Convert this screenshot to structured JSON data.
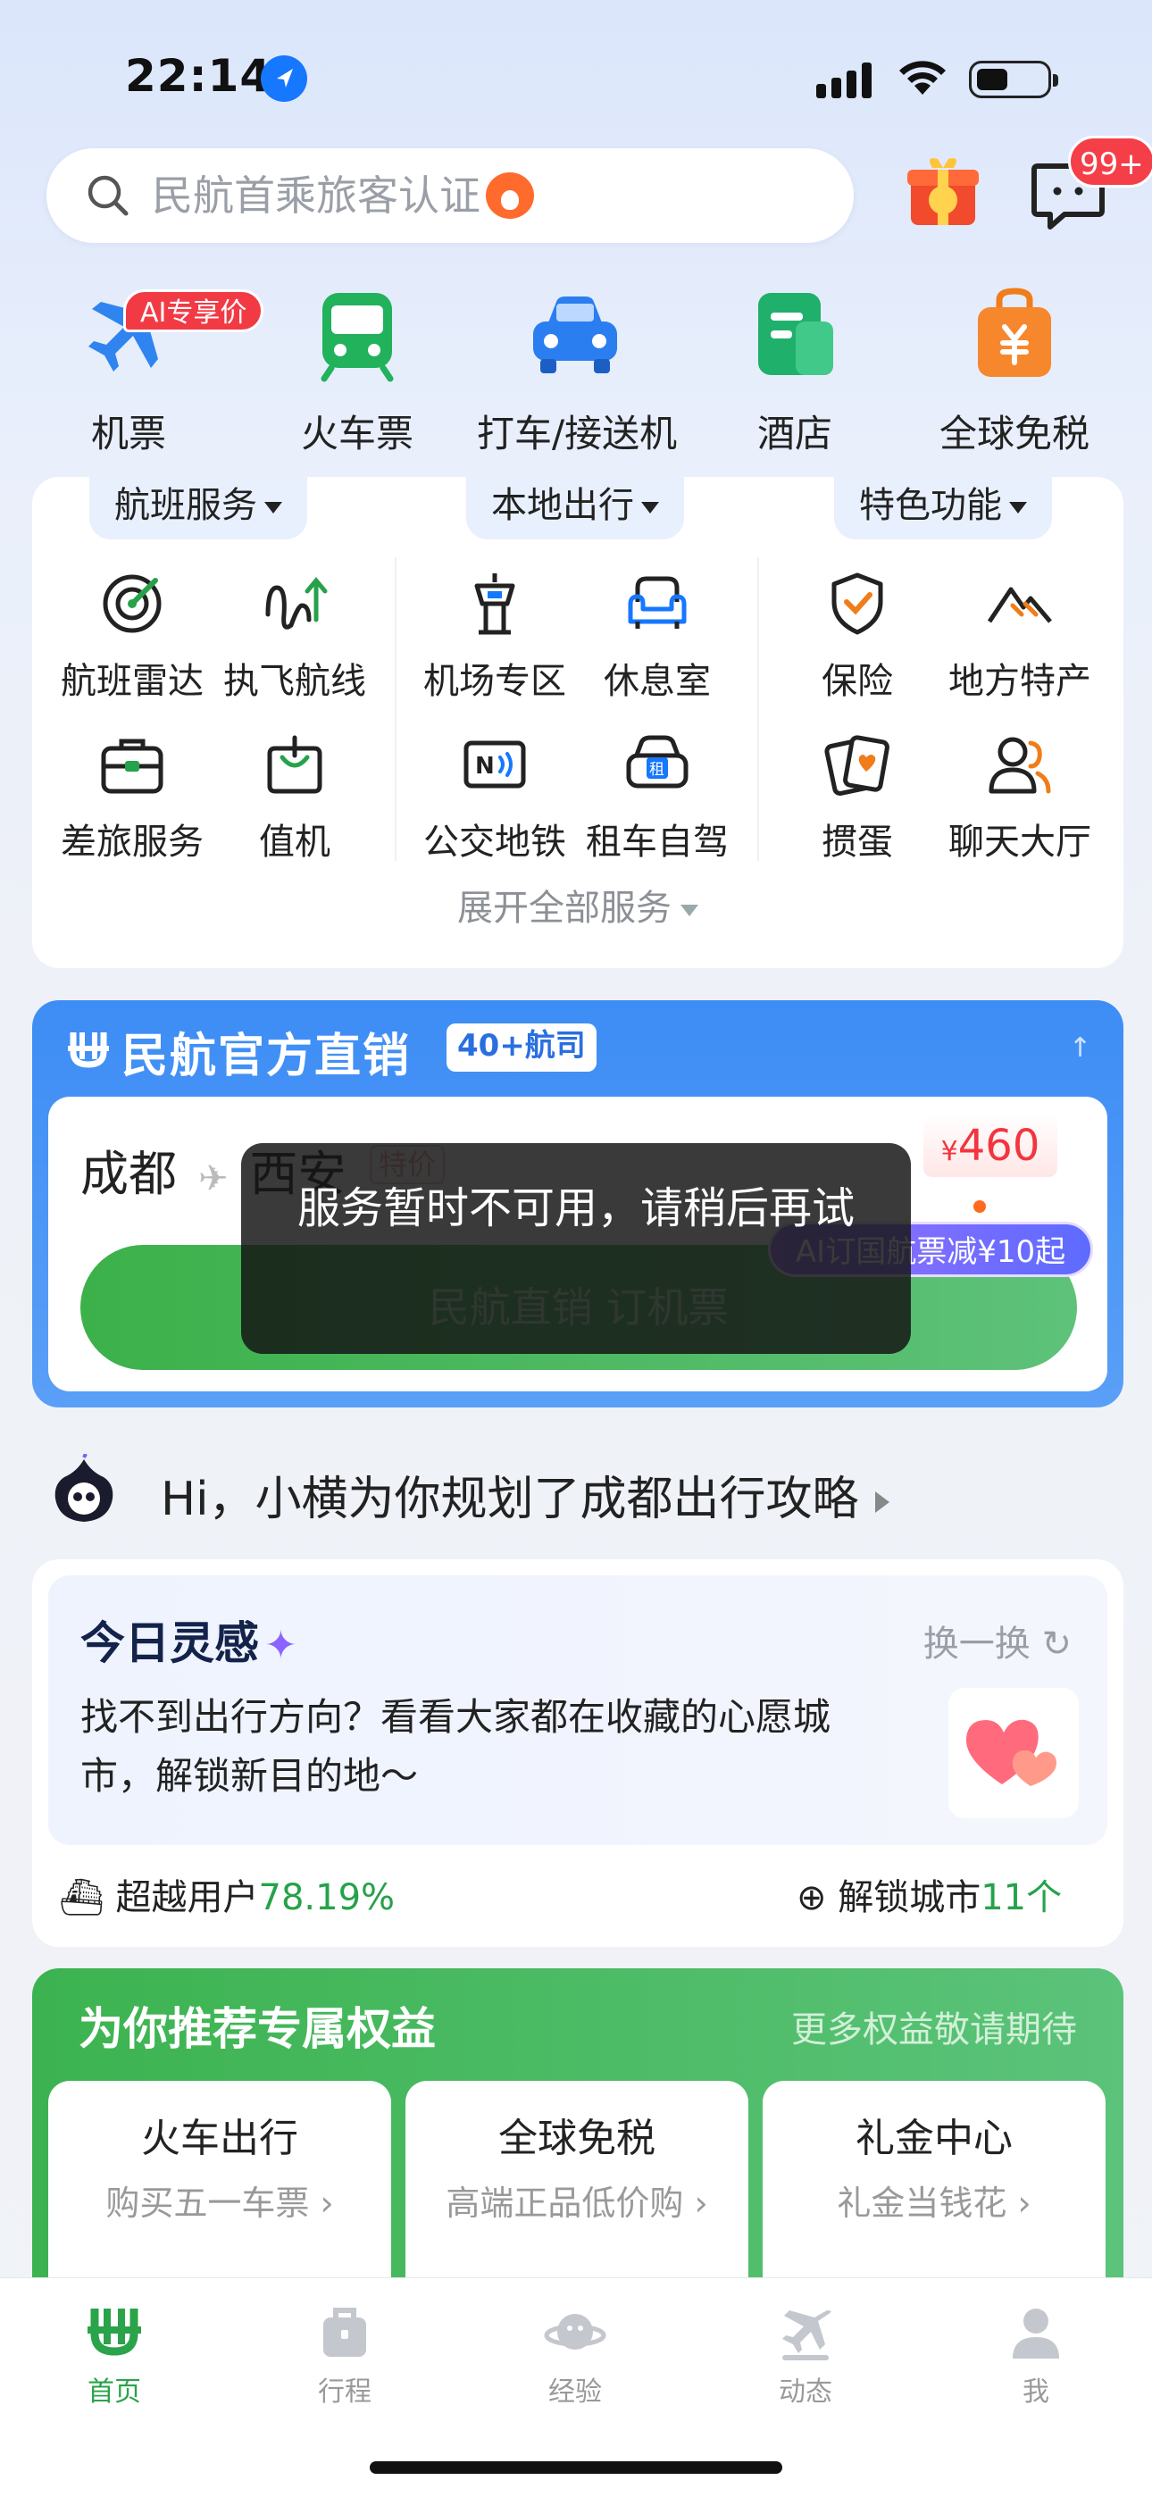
{
  "status_bar": {
    "time": "22:14"
  },
  "search": {
    "placeholder": "民航首乘旅客认证"
  },
  "header": {
    "message_badge": "99+"
  },
  "categories": [
    {
      "label": "机票",
      "tag": "AI专享价"
    },
    {
      "label": "火车票"
    },
    {
      "label": "打车/接送机"
    },
    {
      "label": "酒店"
    },
    {
      "label": "全球免税"
    }
  ],
  "services": {
    "tabs": [
      "航班服务",
      "本地出行",
      "特色功能"
    ],
    "items": [
      "航班雷达",
      "执飞航线",
      "机场专区",
      "休息室",
      "保险",
      "地方特产",
      "差旅服务",
      "值机",
      "公交地铁",
      "租车自驾",
      "掼蛋",
      "聊天大厅"
    ],
    "expand_label": "展开全部服务"
  },
  "official": {
    "title": "民航官方直销",
    "tag": "40+航司",
    "from": "成都",
    "to": "西安",
    "special": "特价",
    "price": "460",
    "currency": "¥",
    "promo": "AI订国航票减¥10起",
    "button": "民航直销 订机票"
  },
  "toast": {
    "text": "服务暂时不可用，请稍后再试"
  },
  "planner": {
    "text": "Hi，小横为你规划了成都出行攻略"
  },
  "inspiration": {
    "title": "今日灵感",
    "refresh": "换一换",
    "desc": "找不到出行方向？看看大家都在收藏的心愿城市，解锁新目的地～",
    "stat_label_1": "超越用户",
    "stat_value_1": "78.19%",
    "stat_label_2": "解锁城市",
    "stat_value_2": "11个"
  },
  "benefits": {
    "title": "为你推荐专属权益",
    "more": "更多权益敬请期待",
    "cards": [
      {
        "title": "火车出行",
        "sub": "购买五一车票"
      },
      {
        "title": "全球免税",
        "sub": "高端正品低价购"
      },
      {
        "title": "礼金中心",
        "sub": "礼金当钱花"
      }
    ]
  },
  "tabbar": [
    {
      "label": "首页"
    },
    {
      "label": "行程"
    },
    {
      "label": "经验"
    },
    {
      "label": "动态"
    },
    {
      "label": "我"
    }
  ],
  "colors": {
    "brand_green": "#2aa34a",
    "accent_blue": "#3d8df5",
    "badge_red": "#f43f49"
  }
}
